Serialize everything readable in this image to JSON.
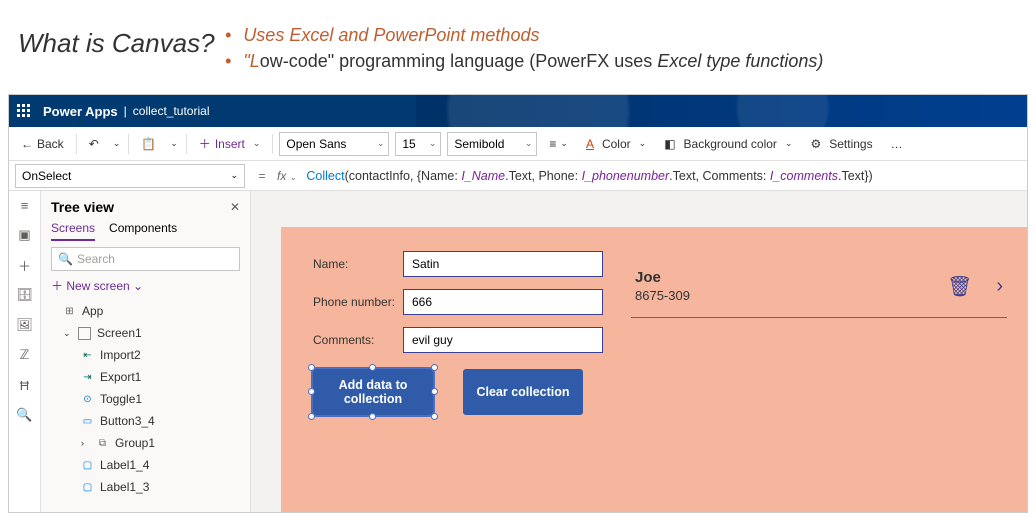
{
  "slide": {
    "title": "What is Canvas?",
    "bullet1": "Uses Excel and PowerPoint methods",
    "bullet2_pre": "\"L",
    "bullet2_mid": "ow-code\" programming language (PowerFX uses ",
    "bullet2_ital": "Excel type functions)"
  },
  "appbar": {
    "brand": "Power Apps",
    "appname": "collect_tutorial"
  },
  "cmdbar": {
    "back": "Back",
    "insert": "Insert",
    "font": "Open Sans",
    "size": "15",
    "weight": "Semibold",
    "color": "Color",
    "bg": "Background color",
    "settings": "Settings"
  },
  "propbar": {
    "prop": "OnSelect",
    "eq": "=",
    "fx": "fx",
    "formula_tokens": [
      {
        "t": "fn",
        "v": "Collect"
      },
      {
        "t": "txt",
        "v": "(contactInfo, {Name: "
      },
      {
        "t": "var",
        "v": "I_Name"
      },
      {
        "t": "txt",
        "v": ".Text, Phone: "
      },
      {
        "t": "var",
        "v": "I_phonenumber"
      },
      {
        "t": "txt",
        "v": ".Text, Comments: "
      },
      {
        "t": "var",
        "v": "I_comments"
      },
      {
        "t": "txt",
        "v": ".Text})"
      }
    ]
  },
  "tree": {
    "title": "Tree view",
    "tab_screens": "Screens",
    "tab_components": "Components",
    "search": "Search",
    "newscreen": "New screen",
    "app": "App",
    "items": [
      "Screen1",
      "Import2",
      "Export1",
      "Toggle1",
      "Button3_4",
      "Group1",
      "Label1_4",
      "Label1_3"
    ]
  },
  "form": {
    "label_name": "Name:",
    "label_phone": "Phone number:",
    "label_comments": "Comments:",
    "val_name": "Satin",
    "val_phone": "666",
    "val_comments": "evil guy",
    "btn_add": "Add data to collection",
    "btn_clear": "Clear collection"
  },
  "gallery": {
    "item1_name": "Joe",
    "item1_phone": "8675-309"
  }
}
